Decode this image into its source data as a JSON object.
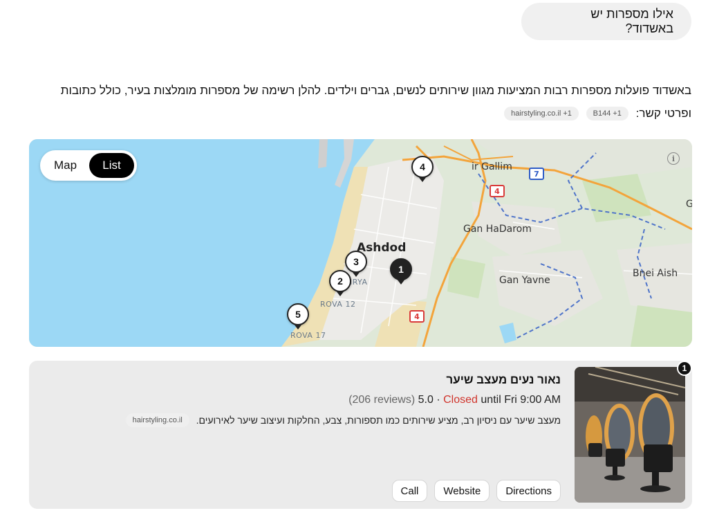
{
  "user_message": "אילו מספרות יש באשדוד?",
  "answer": {
    "text": "באשדוד פועלות מספרות רבות המציעות מגוון שירותים לנשים, גברים וילדים. להלן רשימה של מספרות מומלצות בעיר, כולל כתובות ופרטי קשר:",
    "sources": [
      "B144 +1",
      "hairstyling.co.il +1"
    ]
  },
  "map": {
    "toggle": {
      "map_label": "Map",
      "list_label": "List",
      "active": "List"
    },
    "labels": {
      "ashdod": "Ashdod",
      "gan_hadarom": "Gan HaDarom",
      "gan_yavne": "Gan Yavne",
      "bnei_aish": "Bnei Aish",
      "kiryat_gallim": "ir Gallim",
      "rova12": "ROVA 12",
      "rova17": "ROVA 17",
      "kirya": "IRYA",
      "edge_c": "G"
    },
    "shields": {
      "road4_a": "4",
      "road4_b": "4",
      "road7": "7"
    },
    "pins": [
      "1",
      "2",
      "3",
      "4",
      "5"
    ],
    "info_icon": "info-icon"
  },
  "results": [
    {
      "rank": "1",
      "name": "נאור נעים מעצב שיער",
      "rating": "5.0",
      "reviews": "(206 reviews)",
      "status": "Closed",
      "hours": "until Fri 9:00 AM",
      "separator": "·",
      "description": "מעצב שיער עם ניסיון רב, מציע שירותים כמו תספורות, צבע, החלקות ועיצוב שיער לאירועים.",
      "source": "hairstyling.co.il",
      "buttons": {
        "directions": "Directions",
        "website": "Website",
        "call": "Call"
      }
    }
  ],
  "colors": {
    "sea": "#9cd8f5",
    "land": "#dfe8d8",
    "urban": "#ecebe8",
    "road_orange": "#f3a43b",
    "closed": "#d0342c"
  }
}
